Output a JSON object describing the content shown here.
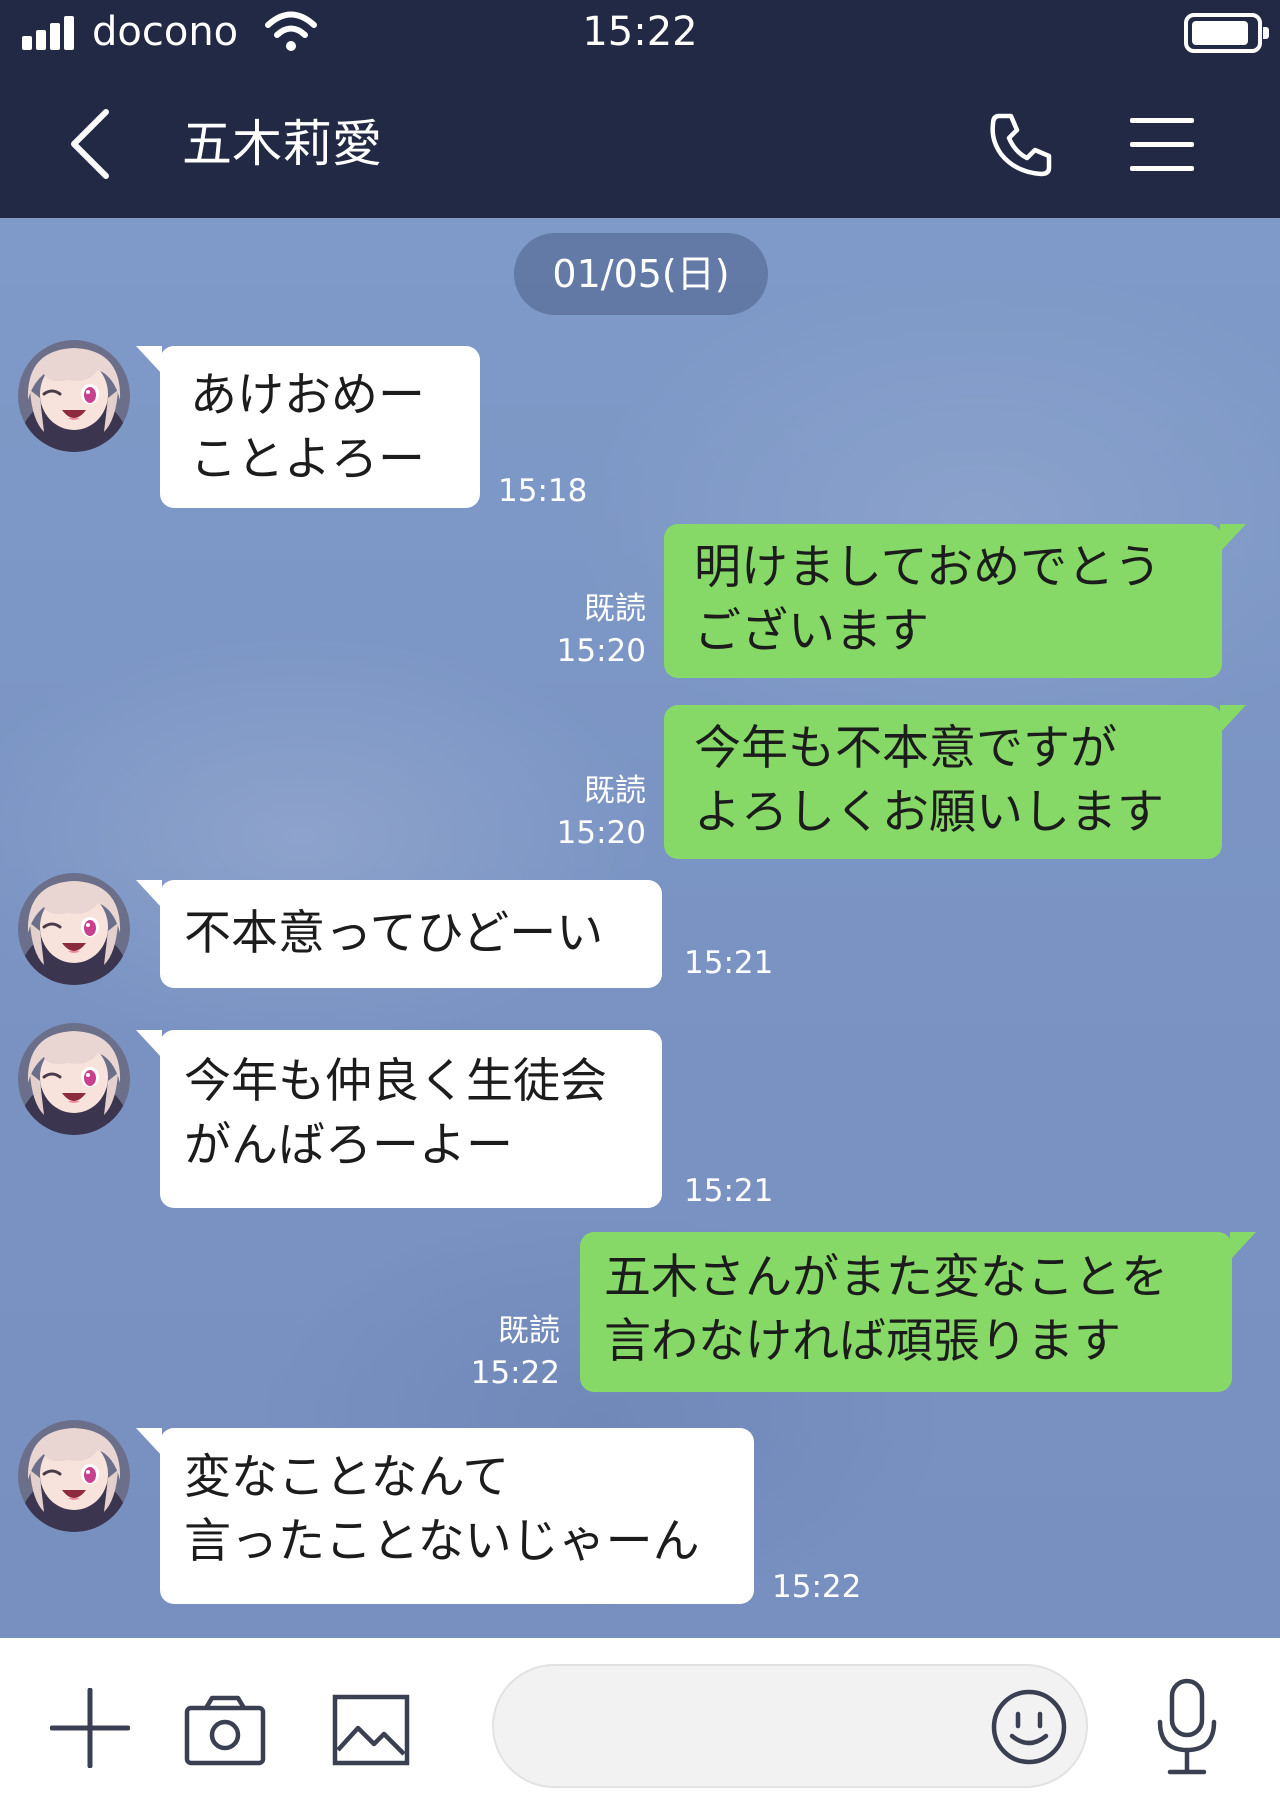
{
  "status_bar": {
    "carrier": "docono",
    "time": "15:22",
    "signal_bars": 4,
    "battery_level": 0.9
  },
  "header": {
    "title": "五木莉愛",
    "icons": [
      "back-chevron-icon",
      "phone-icon",
      "menu-icon"
    ]
  },
  "chat": {
    "date": "01/05(日)",
    "messages": [
      {
        "side": "in",
        "lines": [
          "あけおめー",
          "ことよろー"
        ],
        "time": "15:18"
      },
      {
        "side": "out",
        "lines": [
          "明けましておめでとう",
          "ございます"
        ],
        "read": "既読",
        "time": "15:20"
      },
      {
        "side": "out",
        "lines": [
          "今年も不本意ですが",
          "よろしくお願いします"
        ],
        "read": "既読",
        "time": "15:20"
      },
      {
        "side": "in",
        "lines": [
          "不本意ってひどーい"
        ],
        "time": "15:21"
      },
      {
        "side": "in",
        "lines": [
          "今年も仲良く生徒会",
          "がんばろーよー"
        ],
        "time": "15:21"
      },
      {
        "side": "out",
        "lines": [
          "五木さんがまた変なことを",
          "言わなければ頑張ります"
        ],
        "read": "既読",
        "time": "15:22"
      },
      {
        "side": "in",
        "lines": [
          "変なことなんて",
          "言ったことないじゃーん"
        ],
        "time": "15:22"
      }
    ]
  },
  "input_bar": {
    "icons": [
      "plus-icon",
      "camera-icon",
      "image-icon",
      "emoji-icon",
      "microphone-icon"
    ],
    "text_value": ""
  },
  "colors": {
    "header_bg": "#212944",
    "chat_bg": "#7d95c4",
    "incoming_bubble": "#ffffff",
    "outgoing_bubble": "#86d966"
  }
}
